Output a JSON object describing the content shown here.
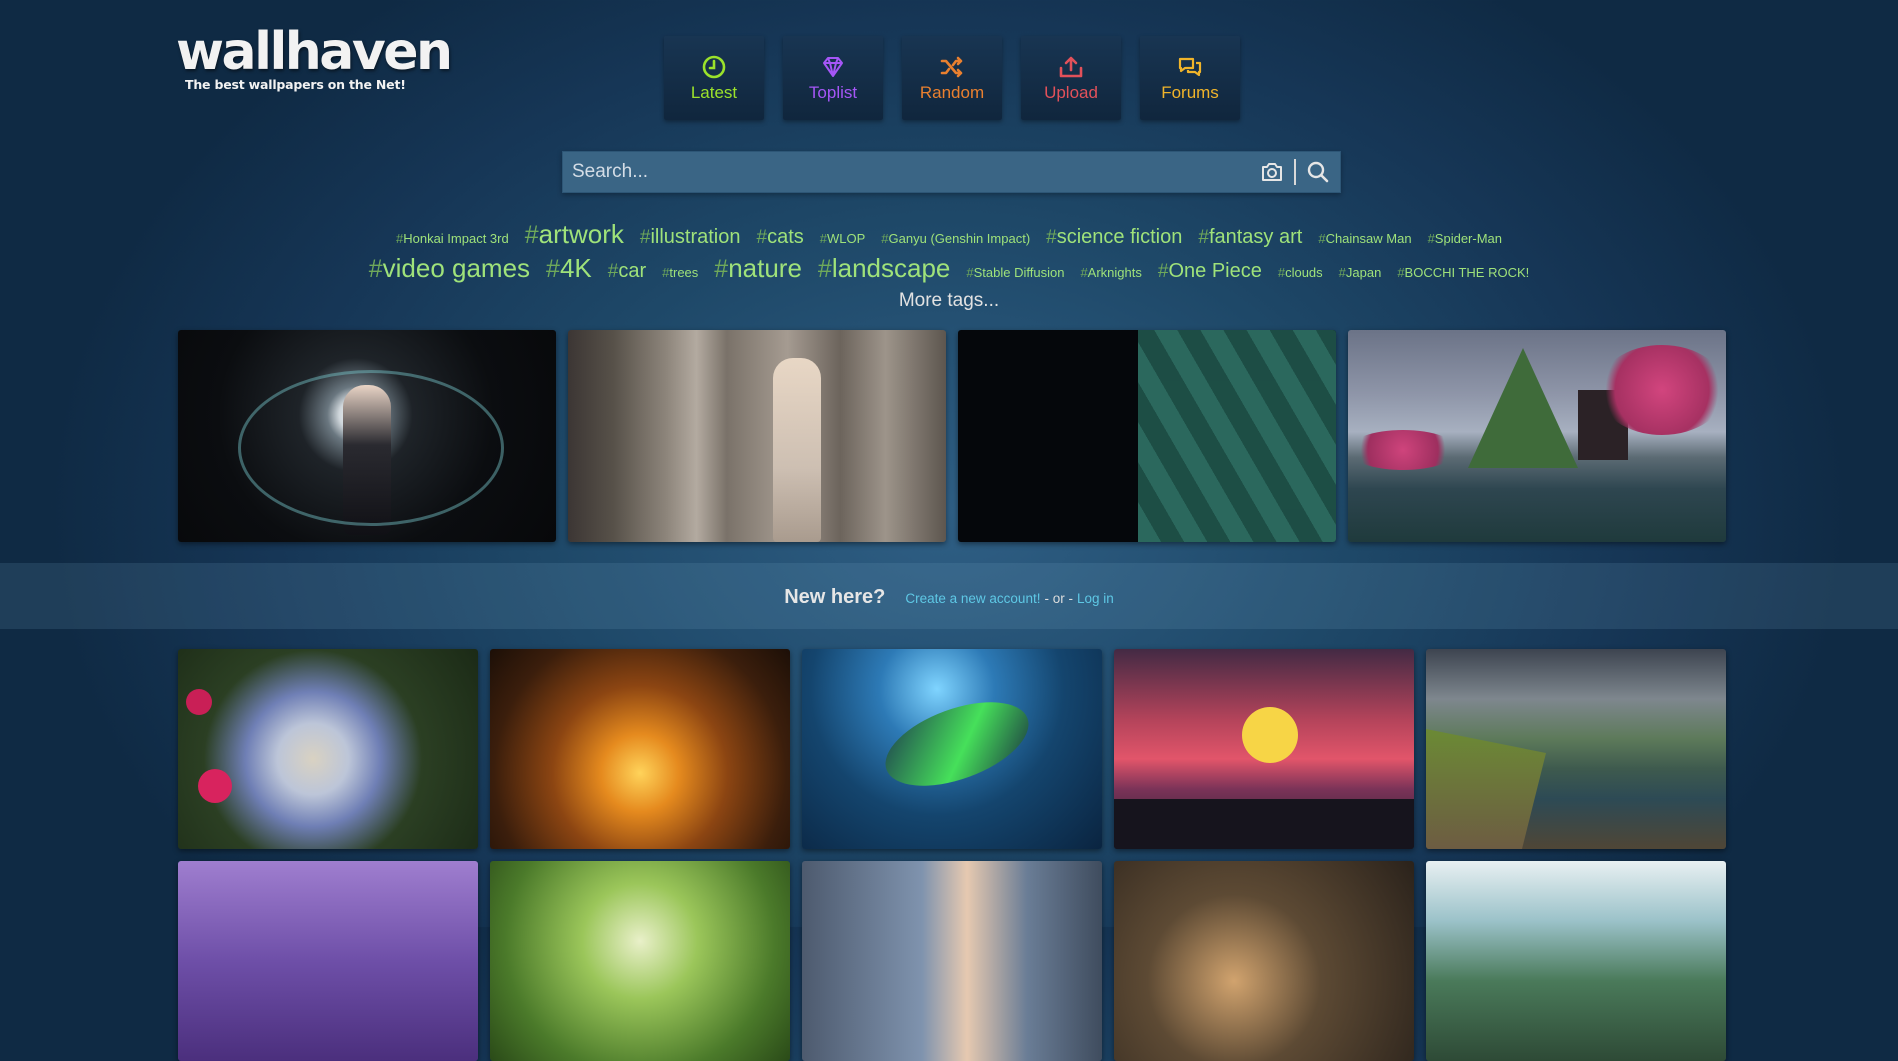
{
  "logo": {
    "name": "wallhaven",
    "tagline": "The best wallpapers on the Net!"
  },
  "nav": [
    {
      "label": "Latest",
      "color": "#9be22b",
      "icon": "clock-icon"
    },
    {
      "label": "Toplist",
      "color": "#a556f6",
      "icon": "diamond-icon"
    },
    {
      "label": "Random",
      "color": "#e9802f",
      "icon": "shuffle-icon"
    },
    {
      "label": "Upload",
      "color": "#e2515a",
      "icon": "upload-icon"
    },
    {
      "label": "Forums",
      "color": "#f0b42a",
      "icon": "chat-icon"
    }
  ],
  "search": {
    "placeholder": "Search...",
    "camera_icon": "camera-icon",
    "search_icon": "search-icon"
  },
  "tags": {
    "row1": [
      {
        "name": "Honkai Impact 3rd",
        "size": "small"
      },
      {
        "name": "artwork",
        "size": "large"
      },
      {
        "name": "illustration",
        "size": "medium"
      },
      {
        "name": "cats",
        "size": "medium"
      },
      {
        "name": "WLOP",
        "size": "small"
      },
      {
        "name": "Ganyu (Genshin Impact)",
        "size": "small"
      },
      {
        "name": "science fiction",
        "size": "medium"
      },
      {
        "name": "fantasy art",
        "size": "medium"
      },
      {
        "name": "Chainsaw Man",
        "size": "small"
      },
      {
        "name": "Spider-Man",
        "size": "small"
      }
    ],
    "row2": [
      {
        "name": "video games",
        "size": "large"
      },
      {
        "name": "4K",
        "size": "large"
      },
      {
        "name": "car",
        "size": "medium"
      },
      {
        "name": "trees",
        "size": "small"
      },
      {
        "name": "nature",
        "size": "large"
      },
      {
        "name": "landscape",
        "size": "large"
      },
      {
        "name": "Stable Diffusion",
        "size": "small"
      },
      {
        "name": "Arknights",
        "size": "small"
      },
      {
        "name": "One Piece",
        "size": "medium"
      },
      {
        "name": "clouds",
        "size": "small"
      },
      {
        "name": "Japan",
        "size": "small"
      },
      {
        "name": "BOCCHI THE ROCK!",
        "size": "small"
      }
    ],
    "more": "More tags..."
  },
  "featured": [
    "anime-girl-twin-tails-wallpaper",
    "woman-white-dress-columns-wallpaper",
    "green-hexagon-pattern-wallpaper",
    "pixel-art-pagoda-landscape-wallpaper"
  ],
  "signup": {
    "question": "New here?",
    "create": "Create a new account!",
    "or": "- or -",
    "login": "Log in"
  },
  "grid": [
    "astronaut-skull-flowers",
    "workshop-interior",
    "neon-shark-underwater",
    "sunset-city-cat",
    "sea-cliffs-landscape",
    "purple-city-street",
    "green-tree",
    "woman-portrait",
    "plant-closeup",
    "mountain-road"
  ]
}
